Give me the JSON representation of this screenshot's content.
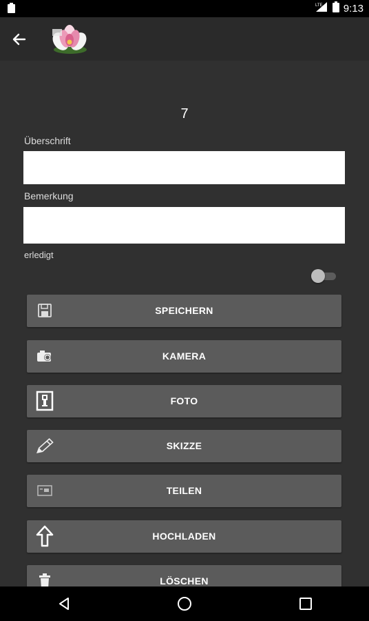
{
  "status_bar": {
    "time": "9:13",
    "network_label": "LTE"
  },
  "record": {
    "number": "7"
  },
  "fields": {
    "heading_label": "Überschrift",
    "heading_value": "",
    "remark_label": "Bemerkung",
    "remark_value": "",
    "done_label": "erledigt",
    "done_checked": false
  },
  "buttons": [
    {
      "label": "SPEICHERN",
      "icon": "floppy-disk-icon"
    },
    {
      "label": "KAMERA",
      "icon": "camera-icon"
    },
    {
      "label": "FOTO",
      "icon": "photo-icon"
    },
    {
      "label": "SKIZZE",
      "icon": "pencil-icon"
    },
    {
      "label": "TEILEN",
      "icon": "share-icon"
    },
    {
      "label": "HOCHLADEN",
      "icon": "upload-arrow-icon"
    },
    {
      "label": "LÖSCHEN",
      "icon": "trash-icon"
    }
  ],
  "colors": {
    "background": "#303030",
    "app_bar": "#2a2a2a",
    "button": "#5b5b5b",
    "input": "#ffffff"
  }
}
